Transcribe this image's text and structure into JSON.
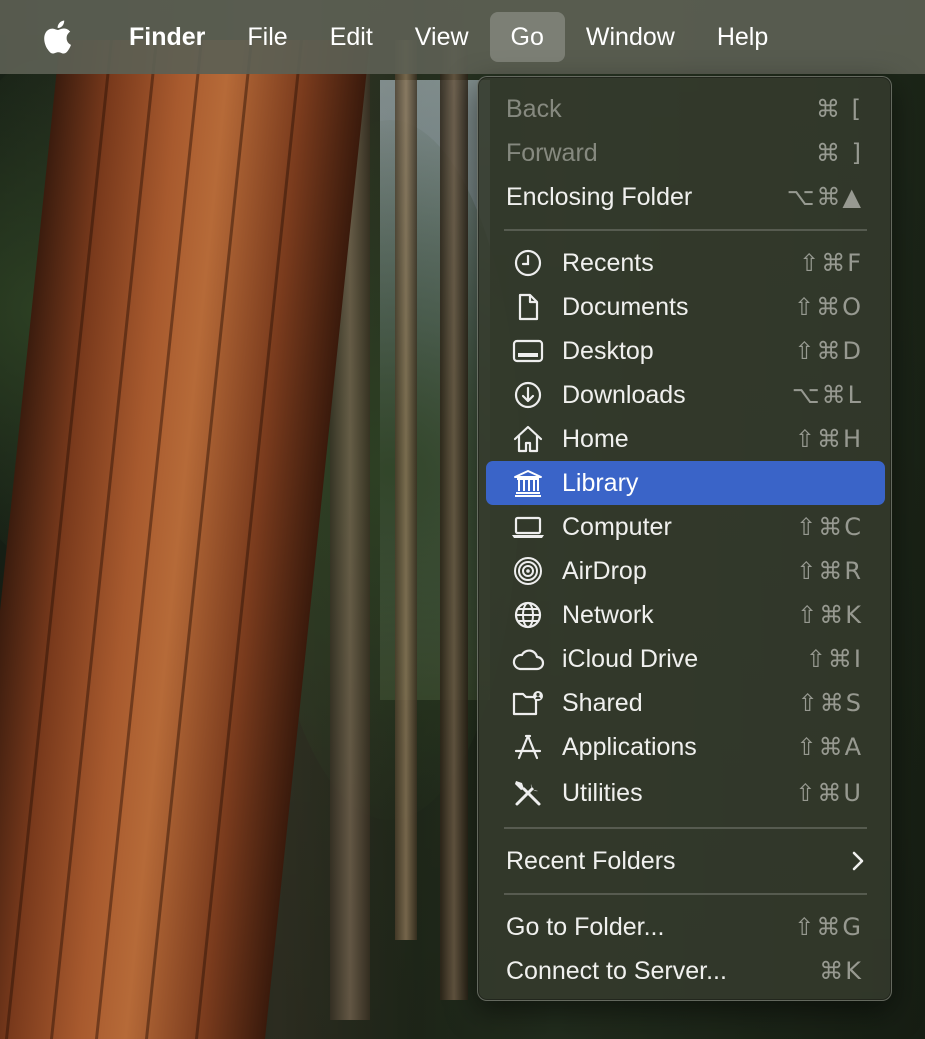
{
  "menubar": {
    "apple_icon": "apple-logo-icon",
    "items": [
      {
        "label": "Finder",
        "bold": true
      },
      {
        "label": "File"
      },
      {
        "label": "Edit"
      },
      {
        "label": "View"
      },
      {
        "label": "Go",
        "active": true
      },
      {
        "label": "Window"
      },
      {
        "label": "Help"
      }
    ]
  },
  "go_menu": {
    "items": [
      {
        "label": "Back",
        "shortcut": "⌘ [",
        "disabled": true
      },
      {
        "label": "Forward",
        "shortcut": "⌘ ]",
        "disabled": true
      },
      {
        "label": "Enclosing Folder",
        "shortcut": "⌥⌘▲"
      },
      {
        "label": "Recents",
        "shortcut": "⇧⌘F",
        "icon": "clock-icon"
      },
      {
        "label": "Documents",
        "shortcut": "⇧⌘O",
        "icon": "document-icon"
      },
      {
        "label": "Desktop",
        "shortcut": "⇧⌘D",
        "icon": "desktop-icon"
      },
      {
        "label": "Downloads",
        "shortcut": "⌥⌘L",
        "icon": "download-icon"
      },
      {
        "label": "Home",
        "shortcut": "⇧⌘H",
        "icon": "home-icon"
      },
      {
        "label": "Library",
        "shortcut": "",
        "icon": "library-icon",
        "selected": true
      },
      {
        "label": "Computer",
        "shortcut": "⇧⌘C",
        "icon": "laptop-icon"
      },
      {
        "label": "AirDrop",
        "shortcut": "⇧⌘R",
        "icon": "airdrop-icon"
      },
      {
        "label": "Network",
        "shortcut": "⇧⌘K",
        "icon": "globe-icon"
      },
      {
        "label": "iCloud Drive",
        "shortcut": "⇧⌘I",
        "icon": "cloud-icon"
      },
      {
        "label": "Shared",
        "shortcut": "⇧⌘S",
        "icon": "shared-folder-icon"
      },
      {
        "label": "Applications",
        "shortcut": "⇧⌘A",
        "icon": "applications-icon"
      },
      {
        "label": "Utilities",
        "shortcut": "⇧⌘U",
        "icon": "utilities-icon"
      },
      {
        "label": "Recent Folders",
        "submenu": true,
        "chevron_icon": "chevron-right-icon"
      },
      {
        "label": "Go to Folder...",
        "shortcut": "⇧⌘G"
      },
      {
        "label": "Connect to Server...",
        "shortcut": "⌘K"
      }
    ]
  },
  "colors": {
    "menubar_bg": "#5c6054",
    "menu_bg": "#343a2c",
    "selection": "#3a64c8"
  }
}
